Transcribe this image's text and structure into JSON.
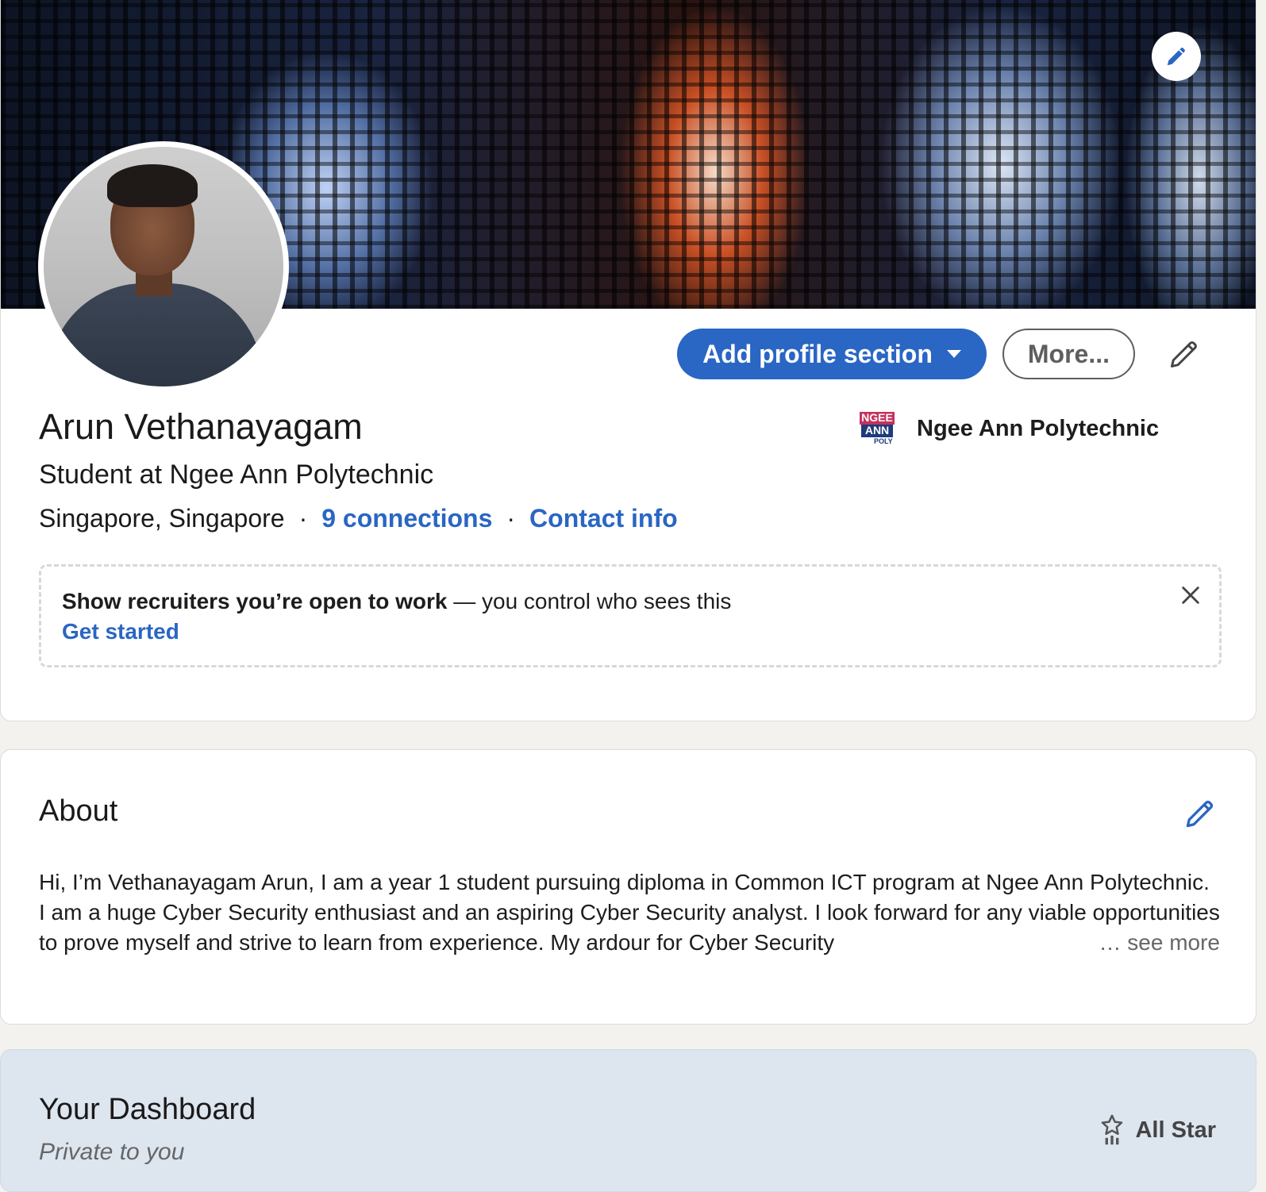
{
  "profile": {
    "name": "Arun Vethanayagam",
    "headline": "Student at Ngee Ann Polytechnic",
    "location": "Singapore, Singapore",
    "separator": "·",
    "connections": "9 connections",
    "contact_info": "Contact info",
    "education": {
      "name": "Ngee Ann Polytechnic",
      "logo_text": [
        "NGEE",
        "ANN",
        "POLY"
      ]
    }
  },
  "actions": {
    "add_section": "Add profile section",
    "more": "More..."
  },
  "open_to_work": {
    "bold": "Show recruiters you’re open to work",
    "rest": " — you control who sees this",
    "cta": "Get started"
  },
  "about": {
    "title": "About",
    "text": "Hi, I’m Vethanayagam Arun, I am a year 1 student pursuing diploma in Common ICT program at Ngee Ann Polytechnic. I am a huge Cyber Security enthusiast and an aspiring Cyber Security analyst. I look forward for any viable opportunities to prove myself and strive to learn from experience. My ardour for Cyber Security",
    "see_more": "… see more"
  },
  "dashboard": {
    "title": "Your Dashboard",
    "subtitle": "Private to you",
    "badge": "All Star"
  },
  "colors": {
    "accent": "#2a66c3",
    "page_bg": "#f3f2ef",
    "dashboard_bg": "#dde5ef"
  },
  "icons": [
    "pencil-icon",
    "caret-down-icon",
    "close-icon",
    "all-star-icon"
  ]
}
